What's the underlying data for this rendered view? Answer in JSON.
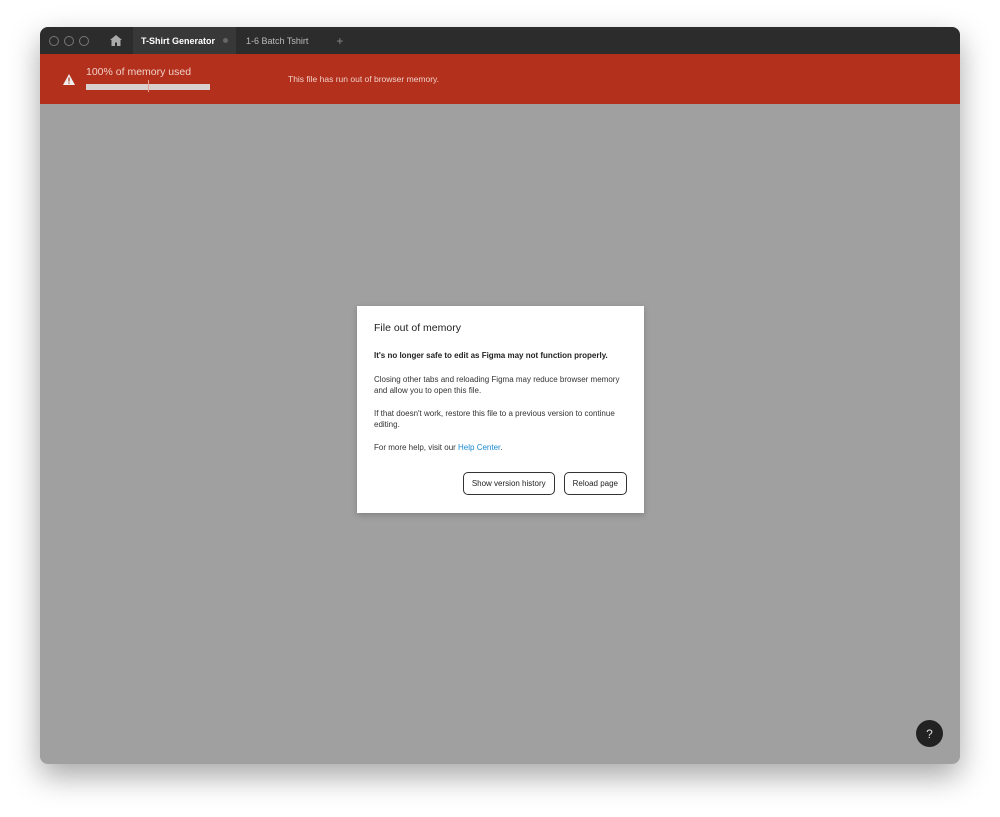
{
  "tabs": {
    "active": "T-Shirt Generator",
    "other": "1-6 Batch Tshirt",
    "new_tab": "+"
  },
  "banner": {
    "memory_label": "100% of memory used",
    "memory_percent": 100,
    "message": "This file has run out of browser memory."
  },
  "dialog": {
    "title": "File out of memory",
    "warning": "It's no longer safe to edit as Figma may not function properly.",
    "para1": "Closing other tabs and reloading Figma may reduce browser memory and allow you to open this file.",
    "para2": "If that doesn't work, restore this file to a previous version to continue editing.",
    "help_prefix": "For more help, visit our ",
    "help_link": "Help Center",
    "help_suffix": ".",
    "show_history": "Show version history",
    "reload": "Reload page"
  },
  "help_button": "?"
}
